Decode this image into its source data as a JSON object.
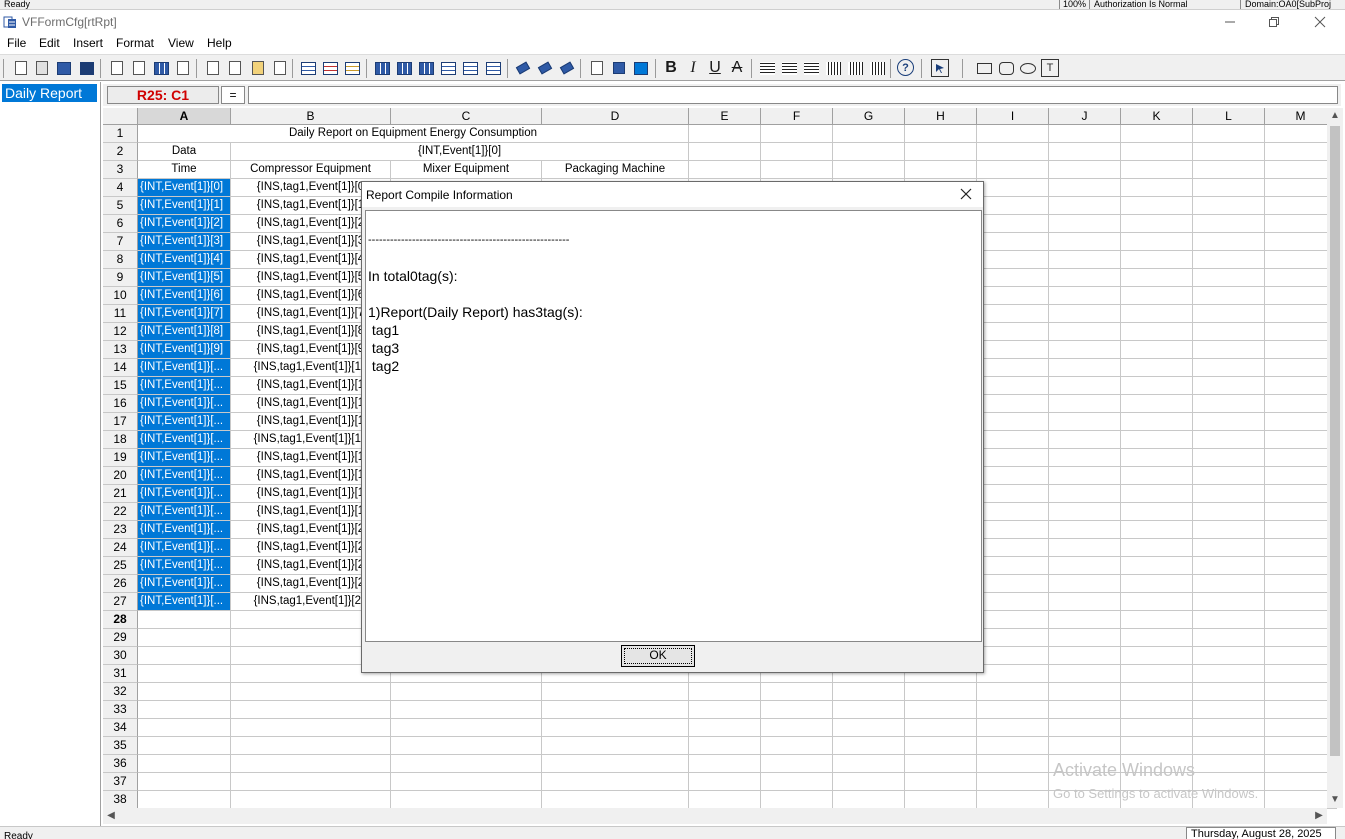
{
  "top_strip": {
    "left": "Ready",
    "zoom": "100%",
    "authorization": "Authorization Is Normal",
    "domain": "Domain:OA0[SubProj"
  },
  "window": {
    "title": "VFFormCfg[rtRpt]",
    "icon": "app-icon",
    "controls": [
      "minimize-icon",
      "restore-icon",
      "close-icon"
    ]
  },
  "menu": [
    "File",
    "Edit",
    "Insert",
    "Format",
    "View",
    "Help"
  ],
  "toolbar": {
    "bold": "B",
    "italic": "I",
    "underline": "U",
    "strike": "A",
    "help": "?",
    "text_tool": "T"
  },
  "left_panel": {
    "items": [
      "Daily Report"
    ]
  },
  "formula_bar": {
    "cell_ref": "R25: C1",
    "equals": "=",
    "value": ""
  },
  "grid": {
    "columns": [
      "A",
      "B",
      "C",
      "D",
      "E",
      "F",
      "G",
      "H",
      "I",
      "J",
      "K",
      "L",
      "M"
    ],
    "rows": [
      "1",
      "2",
      "3",
      "4",
      "5",
      "6",
      "7",
      "8",
      "9",
      "10",
      "11",
      "12",
      "13",
      "14",
      "15",
      "16",
      "17",
      "18",
      "19",
      "20",
      "21",
      "22",
      "23",
      "24",
      "25",
      "26",
      "27",
      "28",
      "29",
      "30",
      "31",
      "32",
      "33",
      "34",
      "35",
      "36",
      "37",
      "38"
    ],
    "title": "Daily Report on Equipment Energy Consumption",
    "data_label": "Data",
    "data_value": "{INT,Event[1]}[0]",
    "headers": [
      "Time",
      "Compressor Equipment",
      "Mixer Equipment",
      "Packaging Machine"
    ],
    "col_a": [
      "{INT,Event[1]}[0]",
      "{INT,Event[1]}[1]",
      "{INT,Event[1]}[2]",
      "{INT,Event[1]}[3]",
      "{INT,Event[1]}[4]",
      "{INT,Event[1]}[5]",
      "{INT,Event[1]}[6]",
      "{INT,Event[1]}[7]",
      "{INT,Event[1]}[8]",
      "{INT,Event[1]}[9]",
      "{INT,Event[1]}[...",
      "{INT,Event[1]}[...",
      "{INT,Event[1]}[...",
      "{INT,Event[1]}[...",
      "{INT,Event[1]}[...",
      "{INT,Event[1]}[...",
      "{INT,Event[1]}[...",
      "{INT,Event[1]}[...",
      "{INT,Event[1]}[...",
      "{INT,Event[1]}[...",
      "{INT,Event[1]}[...",
      "{INT,Event[1]}[...",
      "{INT,Event[1]}[...",
      "{INT,Event[1]}[..."
    ],
    "col_b": [
      "{INS,tag1,Event[1]}[0",
      "{INS,tag1,Event[1]}[1",
      "{INS,tag1,Event[1]}[2",
      "{INS,tag1,Event[1]}[3",
      "{INS,tag1,Event[1]}[4",
      "{INS,tag1,Event[1]}[5",
      "{INS,tag1,Event[1]}[6",
      "{INS,tag1,Event[1]}[7",
      "{INS,tag1,Event[1]}[8",
      "{INS,tag1,Event[1]}[9",
      "{INS,tag1,Event[1]}[10",
      "{INS,tag1,Event[1]}[1",
      "{INS,tag1,Event[1]}[1",
      "{INS,tag1,Event[1]}[1",
      "{INS,tag1,Event[1]}[14",
      "{INS,tag1,Event[1]}[1",
      "{INS,tag1,Event[1]}[1",
      "{INS,tag1,Event[1]}[1",
      "{INS,tag1,Event[1]}[1",
      "{INS,tag1,Event[1]}[2",
      "{INS,tag1,Event[1]}[2",
      "{INS,tag1,Event[1]}[2",
      "{INS,tag1,Event[1]}[2",
      "{INS,tag1,Event[1]}[24"
    ]
  },
  "statusbar": {
    "left": "Ready",
    "date": "Thursday, August 28, 2025"
  },
  "watermark": {
    "line1": "Activate Windows",
    "line2": "Go to Settings to activate Windows."
  },
  "dialog": {
    "title": "Report Compile Information",
    "separator": "-------------------------------------------------------",
    "lines": [
      "In total0tag(s):",
      "",
      "1)Report(Daily Report) has3tag(s):",
      " tag1",
      " tag3",
      " tag2"
    ],
    "ok_label": "OK"
  },
  "colors": {
    "selection": "#0078d7",
    "cell_ref_text": "#d00000"
  }
}
